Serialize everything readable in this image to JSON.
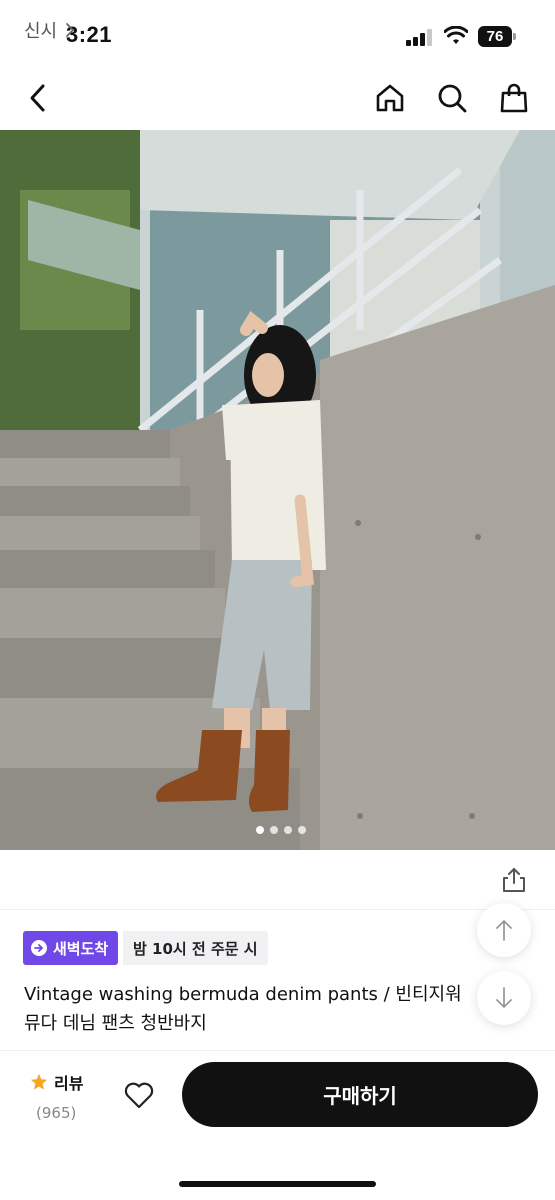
{
  "status_bar": {
    "time": "3:21",
    "battery": "76"
  },
  "nav": {
    "back_icon": "chevron-left-icon",
    "home_icon": "home-icon",
    "search_icon": "search-icon",
    "bag_icon": "shopping-bag-icon"
  },
  "gallery": {
    "page_count": 4,
    "active_index": 0
  },
  "brand": {
    "name": "신시",
    "chevron": "›"
  },
  "badges": {
    "dawn_delivery": "새벽도착",
    "order_deadline": "밤 10시 전 주문 시"
  },
  "product": {
    "title_line1": "Vintage washing bermuda denim pants / 빈티지워",
    "title_line2": "뮤다 데님 팬츠 청반바지"
  },
  "bottom": {
    "review_label": "리뷰",
    "review_count": "(965)",
    "buy_label": "구매하기"
  },
  "colors": {
    "accent_purple": "#7048e8",
    "buy_button": "#111111",
    "star": "#f5a623"
  }
}
